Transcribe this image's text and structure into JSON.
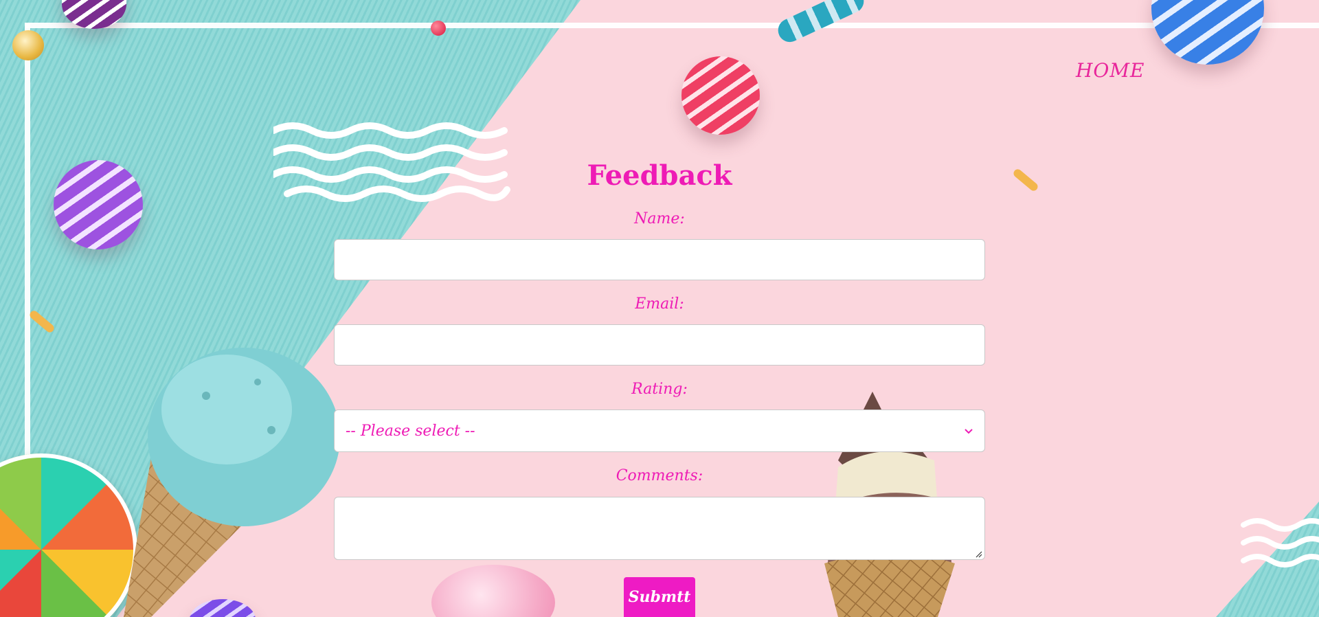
{
  "nav": {
    "home_label": "HOME"
  },
  "form": {
    "title": "Feedback",
    "name_label": "Name:",
    "name_value": "",
    "email_label": "Email:",
    "email_value": "",
    "rating_label": "Rating:",
    "rating_selected": "-- Please select --",
    "comments_label": "Comments:",
    "comments_value": "",
    "submit_label": "Submtt"
  },
  "colors": {
    "accent": "#ee1bb5",
    "button": "#ee1bc4",
    "background_pink": "#fbd6dd",
    "background_teal": "#85d3d2"
  },
  "icons": {
    "rating_dropdown": "chevron-down-icon"
  }
}
